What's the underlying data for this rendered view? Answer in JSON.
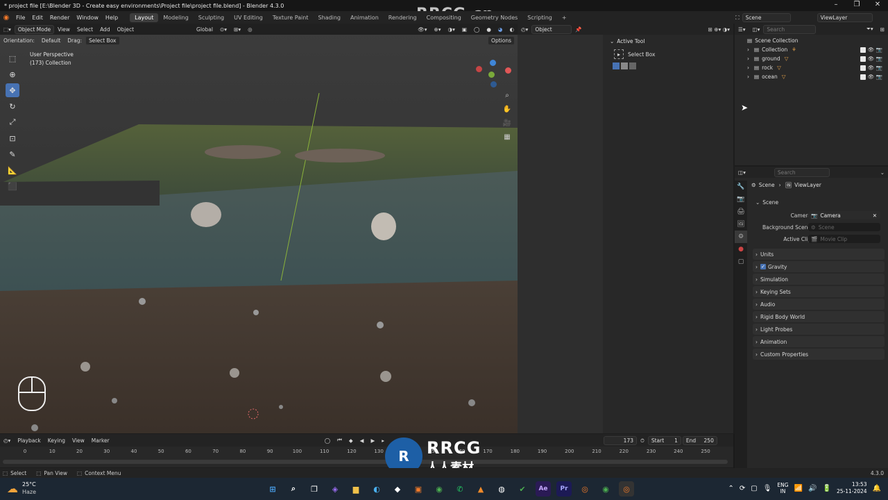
{
  "window": {
    "title": "* project file [E:\\Blender 3D - Create easy environments\\Project file\\project file.blend] - Blender 4.3.0"
  },
  "menubar": {
    "items": [
      "File",
      "Edit",
      "Render",
      "Window",
      "Help"
    ],
    "workspaces": [
      "Layout",
      "Modeling",
      "Sculpting",
      "UV Editing",
      "Texture Paint",
      "Shading",
      "Animation",
      "Rendering",
      "Compositing",
      "Geometry Nodes",
      "Scripting"
    ],
    "active_workspace": "Layout",
    "scene": "Scene",
    "view_layer": "ViewLayer"
  },
  "viewport": {
    "mode": "Object Mode",
    "menu": [
      "View",
      "Select",
      "Add",
      "Object"
    ],
    "transform_orientation": "Global",
    "orientation_label": "Orientation:",
    "orientation_value": "Default",
    "drag_label": "Drag:",
    "drag_value": "Select Box",
    "options": "Options",
    "overlay_line1": "User Perspective",
    "overlay_line2": "(173) Collection"
  },
  "mid_header": {
    "object_dropdown": "Object"
  },
  "active_tool": {
    "title": "Active Tool",
    "tool": "Select Box"
  },
  "outliner": {
    "search_placeholder": "Search",
    "root": "Scene Collection",
    "items": [
      {
        "name": "Collection"
      },
      {
        "name": "ground"
      },
      {
        "name": "rock"
      },
      {
        "name": "ocean"
      }
    ]
  },
  "properties": {
    "search_placeholder": "Search",
    "breadcrumb_scene": "Scene",
    "breadcrumb_layer": "ViewLayer",
    "panel_title": "Scene",
    "camera_label": "Camera",
    "camera_value": "Camera",
    "bg_scene_label": "Background Scene",
    "bg_scene_placeholder": "Scene",
    "active_clip_label": "Active Clip",
    "active_clip_placeholder": "Movie Clip",
    "sections": [
      "Units",
      "Gravity",
      "Simulation",
      "Keying Sets",
      "Audio",
      "Rigid Body World",
      "Light Probes",
      "Animation",
      "Custom Properties"
    ]
  },
  "timeline": {
    "menu": [
      "Playback",
      "Keying",
      "View",
      "Marker"
    ],
    "current_frame": "173",
    "start_label": "Start",
    "start_value": "1",
    "end_label": "End",
    "end_value": "250",
    "ticks": [
      "0",
      "10",
      "20",
      "30",
      "40",
      "50",
      "60",
      "70",
      "80",
      "90",
      "100",
      "110",
      "120",
      "130",
      "140",
      "150",
      "160",
      "170",
      "180",
      "190",
      "200",
      "210",
      "220",
      "230",
      "240",
      "250"
    ]
  },
  "statusbar": {
    "select": "Select",
    "pan": "Pan View",
    "context": "Context Menu",
    "version": "4.3.0"
  },
  "taskbar": {
    "temp": "25°C",
    "weather": "Haze",
    "lang1": "ENG",
    "lang2": "IN",
    "time": "13:53",
    "date": "25-11-2024"
  },
  "watermark": {
    "text": "RRCG.cn",
    "brand": "RRCG",
    "brand_sub": "人人素材"
  }
}
